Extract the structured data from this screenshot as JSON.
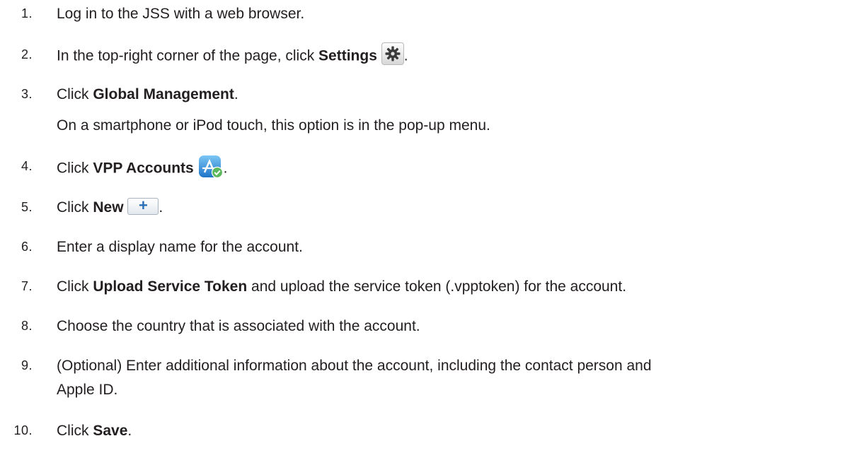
{
  "steps": [
    {
      "num": "1.",
      "parts": [
        "Log in to the JSS with a web browser."
      ]
    },
    {
      "num": "2.",
      "pre": "In the top-right corner of the page, click ",
      "bold": "Settings",
      "post": "."
    },
    {
      "num": "3.",
      "pre": "Click ",
      "bold": "Global Management",
      "post": ".",
      "sub": "On a smartphone or iPod touch, this option is in the pop-up menu."
    },
    {
      "num": "4.",
      "pre": "Click ",
      "bold": "VPP Accounts",
      "post": "."
    },
    {
      "num": "5.",
      "pre": "Click ",
      "bold": "New",
      "post": "."
    },
    {
      "num": "6.",
      "parts": [
        "Enter a display name for the account."
      ]
    },
    {
      "num": "7.",
      "pre": "Click ",
      "bold": "Upload Service Token",
      "post": " and upload the service token (.vpptoken) for the account."
    },
    {
      "num": "8.",
      "parts": [
        "Choose the country that is associated with the account."
      ]
    },
    {
      "num": "9.",
      "line1": "(Optional) Enter additional information about the account, including the contact person and",
      "line2": "Apple ID."
    },
    {
      "num": "10.",
      "pre": "Click ",
      "bold": "Save",
      "post": "."
    }
  ],
  "icons": {
    "settings": "gear-icon",
    "vpp": "app-store-check-icon",
    "new": "plus-icon"
  },
  "colors": {
    "text": "#231f20",
    "plus": "#2a6fb6"
  }
}
